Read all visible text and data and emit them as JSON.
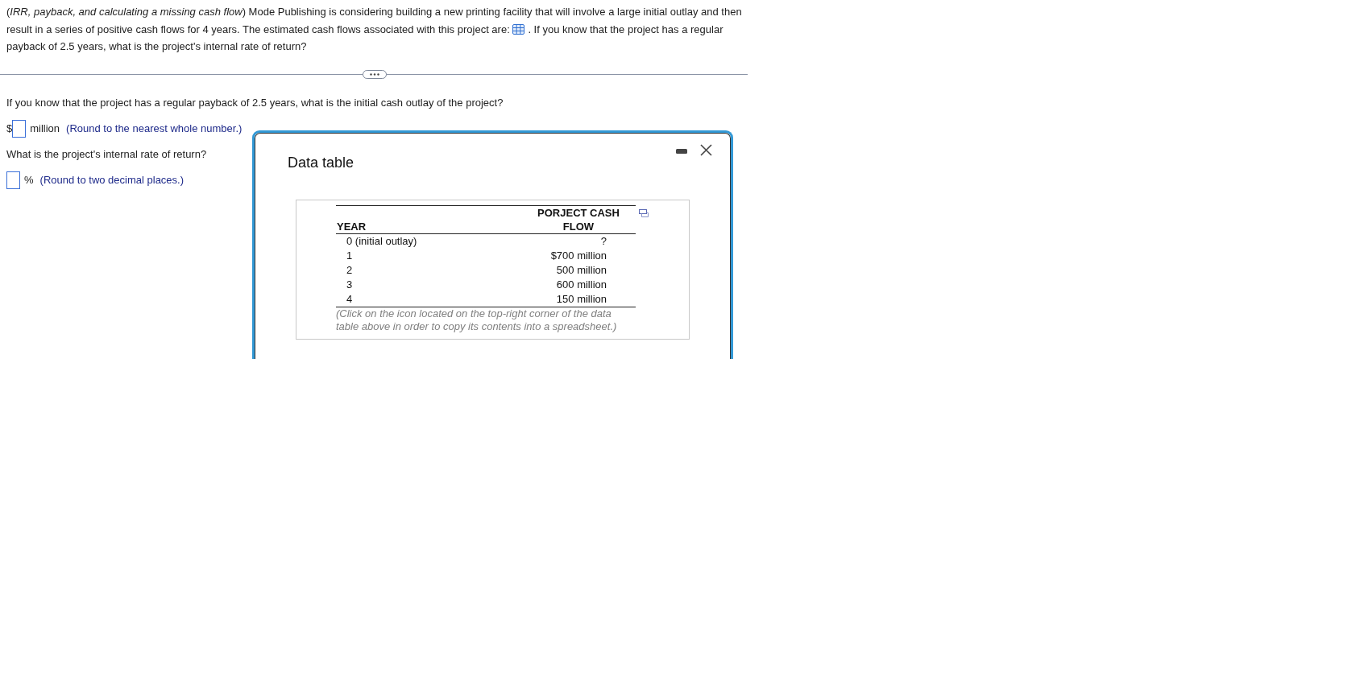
{
  "problem": {
    "text_before_icon": "(*IRR, payback, and calculating a missing cash flow*) Mode Publishing is considering building a new printing facility that will involve a large initial outlay and then result in a series of positive cash flows for 4 years. The estimated cash flows associated with this project are:",
    "text_after_icon": ". If you know that the project has a regular payback of 2.5 years, what is the project's internal rate of return?"
  },
  "questions": [
    {
      "prompt": "If you know that the project has a regular payback of 2.5 years, what is the initial cash outlay of the project?",
      "prefix": "$",
      "suffix": "million",
      "hint": "(Round to the nearest whole number.)"
    },
    {
      "prompt": "What is the project's internal rate of return?",
      "suffix": "%",
      "hint": "(Round to two decimal places.)"
    }
  ],
  "dialog": {
    "title": "Data table",
    "columns": [
      "YEAR",
      "PORJECT CASH FLOW"
    ],
    "rows": [
      [
        "0 (initial outlay)",
        "?"
      ],
      [
        "1",
        "$700 million"
      ],
      [
        "2",
        "500 million"
      ],
      [
        "3",
        "600 million"
      ],
      [
        "4",
        "150 million"
      ]
    ],
    "footnote": "(Click on the icon located on the top-right corner of the data table above in order to copy its contents into a spreadsheet.)"
  }
}
